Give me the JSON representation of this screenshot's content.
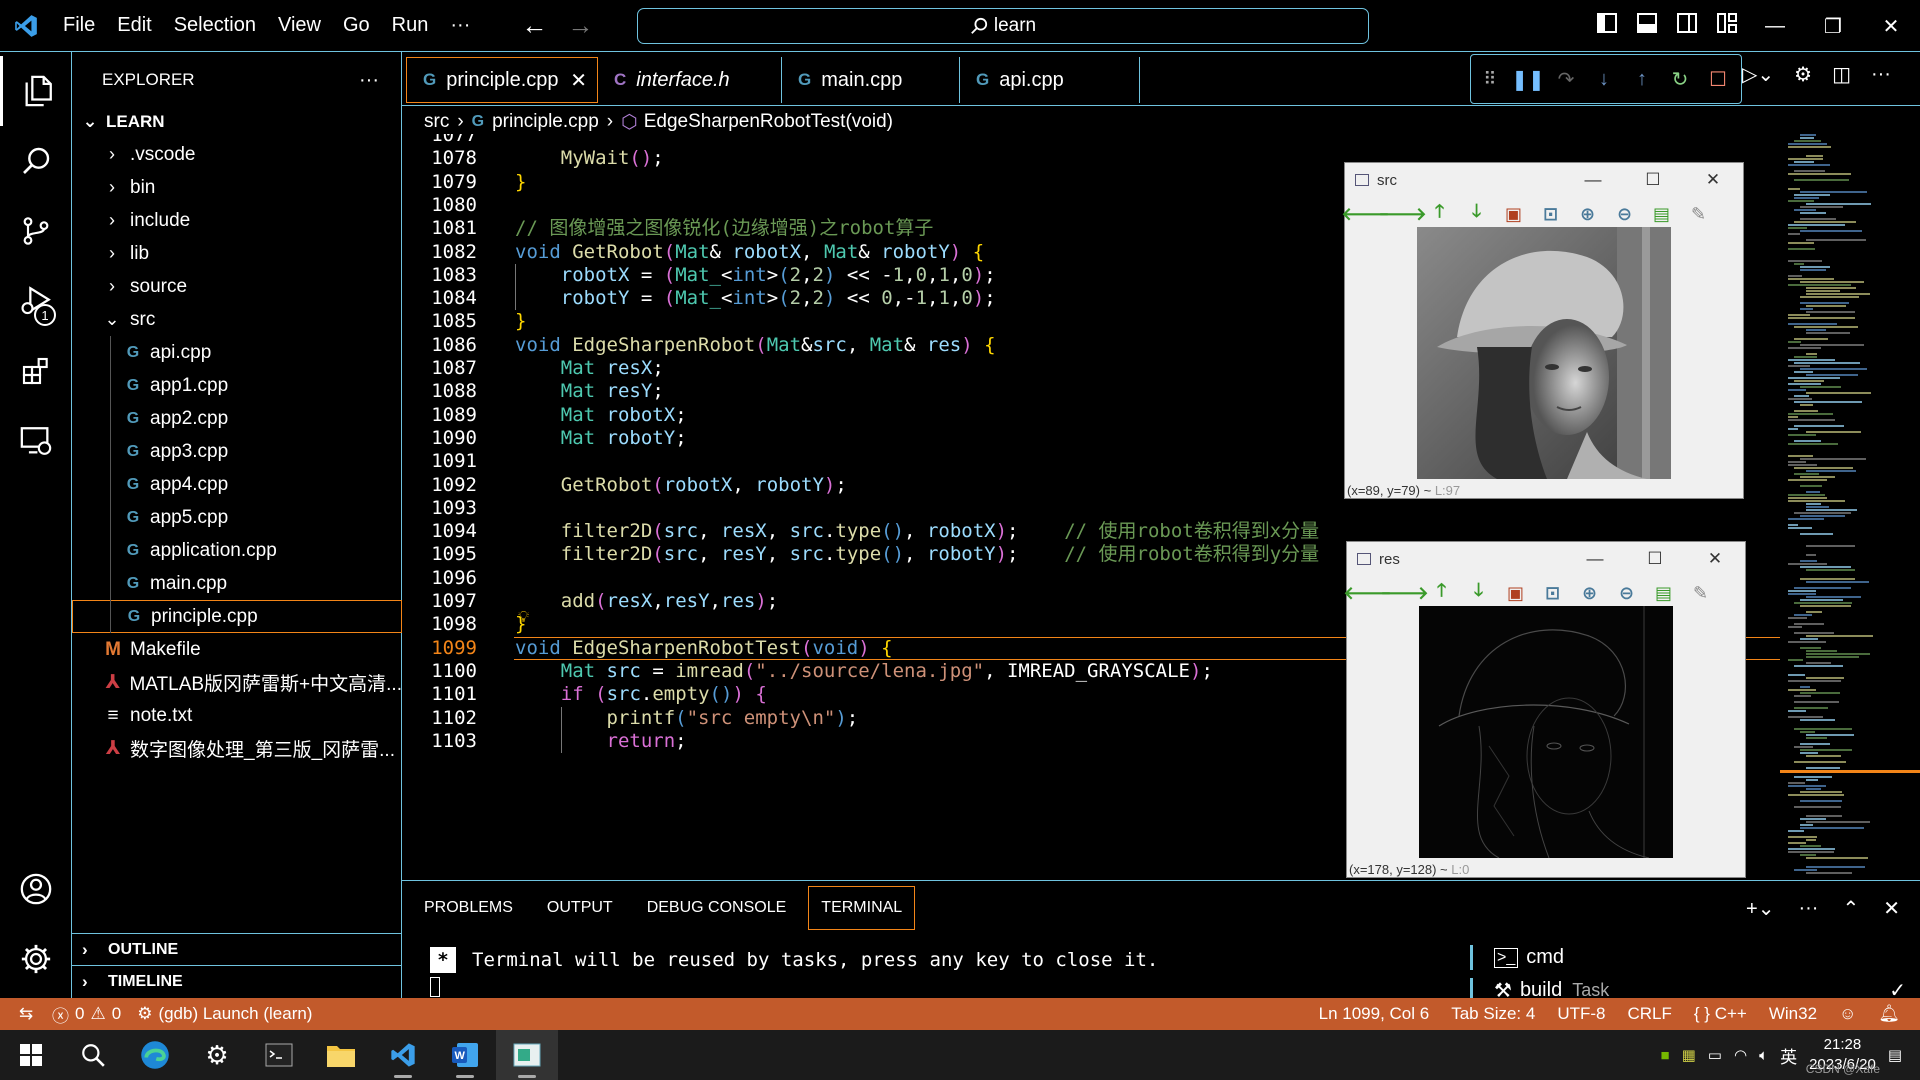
{
  "titlebar": {
    "menu": [
      "File",
      "Edit",
      "Selection",
      "View",
      "Go",
      "Run",
      "···"
    ],
    "search_text": "learn"
  },
  "activitybar": {
    "run_badge": "1"
  },
  "sidebar": {
    "title": "EXPLORER",
    "more": "···",
    "root": "LEARN",
    "items": [
      {
        "label": ".vscode",
        "type": "folder",
        "state": "collapsed"
      },
      {
        "label": "bin",
        "type": "folder",
        "state": "collapsed"
      },
      {
        "label": "include",
        "type": "folder",
        "state": "collapsed"
      },
      {
        "label": "lib",
        "type": "folder",
        "state": "collapsed"
      },
      {
        "label": "source",
        "type": "folder",
        "state": "collapsed"
      },
      {
        "label": "src",
        "type": "folder",
        "state": "expanded"
      },
      {
        "label": "api.cpp",
        "type": "cpp"
      },
      {
        "label": "app1.cpp",
        "type": "cpp"
      },
      {
        "label": "app2.cpp",
        "type": "cpp"
      },
      {
        "label": "app3.cpp",
        "type": "cpp"
      },
      {
        "label": "app4.cpp",
        "type": "cpp"
      },
      {
        "label": "app5.cpp",
        "type": "cpp"
      },
      {
        "label": "application.cpp",
        "type": "cpp"
      },
      {
        "label": "main.cpp",
        "type": "cpp"
      },
      {
        "label": "principle.cpp",
        "type": "cpp",
        "selected": true
      },
      {
        "label": "Makefile",
        "type": "make"
      },
      {
        "label": "MATLAB版冈萨雷斯+中文高清...",
        "type": "pdf"
      },
      {
        "label": "note.txt",
        "type": "txt"
      },
      {
        "label": "数字图像处理_第三版_冈萨雷...",
        "type": "pdf"
      }
    ],
    "outline": "OUTLINE",
    "timeline": "TIMELINE"
  },
  "tabs": [
    {
      "label": "principle.cpp",
      "icon": "G",
      "active": true
    },
    {
      "label": "interface.h",
      "icon": "C",
      "italic": true
    },
    {
      "label": "main.cpp",
      "icon": "G"
    },
    {
      "label": "api.cpp",
      "icon": "G"
    }
  ],
  "breadcrumb": {
    "folder": "src",
    "file": "principle.cpp",
    "symbol": "EdgeSharpenRobotTest(void)"
  },
  "code": {
    "current_line": "1099",
    "lines": [
      {
        "n": "1077",
        "html": ""
      },
      {
        "n": "1078",
        "html": "    <span class='f'>MyWait</span><span class='m'>()</span>;"
      },
      {
        "n": "1079",
        "html": "<span class='y'>}</span>"
      },
      {
        "n": "1080",
        "html": ""
      },
      {
        "n": "1081",
        "html": "<span class='c'>// 图像增强之图像锐化(边缘增强)之robot算子</span>"
      },
      {
        "n": "1082",
        "html": "<span class='k'>void</span> <span class='f'>GetRobot</span><span class='m'>(</span><span class='t'>Mat</span>&amp; <span class='p'>robotX</span>, <span class='t'>Mat</span>&amp; <span class='p'>robotY</span><span class='m'>)</span> <span class='y'>{</span>"
      },
      {
        "n": "1083",
        "html": "    <span class='p'>robotX</span> = <span class='m'>(</span><span class='t'>Mat_</span>&lt;<span class='k'>int</span>&gt;<span class='k'>(</span><span class='n'>2</span>,<span class='n'>2</span><span class='k'>)</span> &lt;&lt; -<span class='n'>1</span>,<span class='n'>0</span>,<span class='n'>1</span>,<span class='n'>0</span><span class='m'>)</span>;"
      },
      {
        "n": "1084",
        "html": "    <span class='p'>robotY</span> = <span class='m'>(</span><span class='t'>Mat_</span>&lt;<span class='k'>int</span>&gt;<span class='k'>(</span><span class='n'>2</span>,<span class='n'>2</span><span class='k'>)</span> &lt;&lt; <span class='n'>0</span>,-<span class='n'>1</span>,<span class='n'>1</span>,<span class='n'>0</span><span class='m'>)</span>;"
      },
      {
        "n": "1085",
        "html": "<span class='y'>}</span>"
      },
      {
        "n": "1086",
        "html": "<span class='k'>void</span> <span class='f'>EdgeSharpenRobot</span><span class='m'>(</span><span class='t'>Mat</span>&amp;<span class='p'>src</span>, <span class='t'>Mat</span>&amp; <span class='p'>res</span><span class='m'>)</span> <span class='y'>{</span>"
      },
      {
        "n": "1087",
        "html": "    <span class='t'>Mat</span> <span class='p'>resX</span>;"
      },
      {
        "n": "1088",
        "html": "    <span class='t'>Mat</span> <span class='p'>resY</span>;"
      },
      {
        "n": "1089",
        "html": "    <span class='t'>Mat</span> <span class='p'>robotX</span>;"
      },
      {
        "n": "1090",
        "html": "    <span class='t'>Mat</span> <span class='p'>robotY</span>;"
      },
      {
        "n": "1091",
        "html": ""
      },
      {
        "n": "1092",
        "html": "    <span class='f'>GetRobot</span><span class='m'>(</span><span class='p'>robotX</span>, <span class='p'>robotY</span><span class='m'>)</span>;"
      },
      {
        "n": "1093",
        "html": ""
      },
      {
        "n": "1094",
        "html": "    <span class='f'>filter2D</span><span class='m'>(</span><span class='p'>src</span>, <span class='p'>resX</span>, <span class='p'>src</span>.<span class='f'>type</span><span class='k'>()</span>, <span class='p'>robotX</span><span class='m'>)</span>;    <span class='c'>// 使用robot卷积得到x分量</span>"
      },
      {
        "n": "1095",
        "html": "    <span class='f'>filter2D</span><span class='m'>(</span><span class='p'>src</span>, <span class='p'>resY</span>, <span class='p'>src</span>.<span class='f'>type</span><span class='k'>()</span>, <span class='p'>robotY</span><span class='m'>)</span>;    <span class='c'>// 使用robot卷积得到y分量</span>"
      },
      {
        "n": "1096",
        "html": ""
      },
      {
        "n": "1097",
        "html": "    <span class='f'>add</span><span class='m'>(</span><span class='p'>resX</span>,<span class='p'>resY</span>,<span class='p'>res</span><span class='m'>)</span>;"
      },
      {
        "n": "1098",
        "html": "<span class='y'>}</span>"
      },
      {
        "n": "1099",
        "html": "<span class='k'>void</span> <span class='f'>EdgeSharpenRobotTest</span><span class='m'>(</span><span class='k'>void</span><span class='m'>)</span> <span class='y'>{</span>"
      },
      {
        "n": "1100",
        "html": "    <span class='t'>Mat</span> <span class='p'>src</span> = <span class='f'>imread</span><span class='m'>(</span><span class='s'>\"../source/lena.jpg\"</span>, <span class='w'>IMREAD_GRAYSCALE</span><span class='m'>)</span>;"
      },
      {
        "n": "1101",
        "html": "    <span class='m'>if</span> <span class='m'>(</span><span class='p'>src</span>.<span class='f'>empty</span><span class='k'>()</span><span class='m'>)</span> <span class='m'>{</span>"
      },
      {
        "n": "1102",
        "html": "        <span class='f'>printf</span><span class='k'>(</span><span class='s'>\"src empty\\n\"</span><span class='k'>)</span>;"
      },
      {
        "n": "1103",
        "html": "        <span class='m'>return</span>;"
      }
    ]
  },
  "windows": [
    {
      "title": "src",
      "status": "(x=89, y=79) ~",
      "status_dim": "L:97"
    },
    {
      "title": "res",
      "status": "(x=178, y=128) ~",
      "status_dim": "L:0"
    }
  ],
  "panel": {
    "tabs": [
      "PROBLEMS",
      "OUTPUT",
      "DEBUG CONSOLE",
      "TERMINAL"
    ],
    "active_tab": "TERMINAL",
    "terminal_text": "Terminal will be reused by tasks, press any key to close it.",
    "terminals": [
      {
        "label": "cmd"
      },
      {
        "label": "build",
        "suffix": "Task"
      }
    ]
  },
  "statusbar": {
    "errors": "0",
    "warnings": "0",
    "launch": "(gdb) Launch (learn)",
    "position": "Ln 1099, Col 6",
    "tabsize": "Tab Size: 4",
    "encoding": "UTF-8",
    "eol": "CRLF",
    "language": "C++",
    "platform": "Win32",
    "color": "#c25a2b"
  },
  "taskbar": {
    "ime": "英",
    "time": "21:28",
    "date": "2023/6/20",
    "watermark": "CSDN @Xafe"
  }
}
